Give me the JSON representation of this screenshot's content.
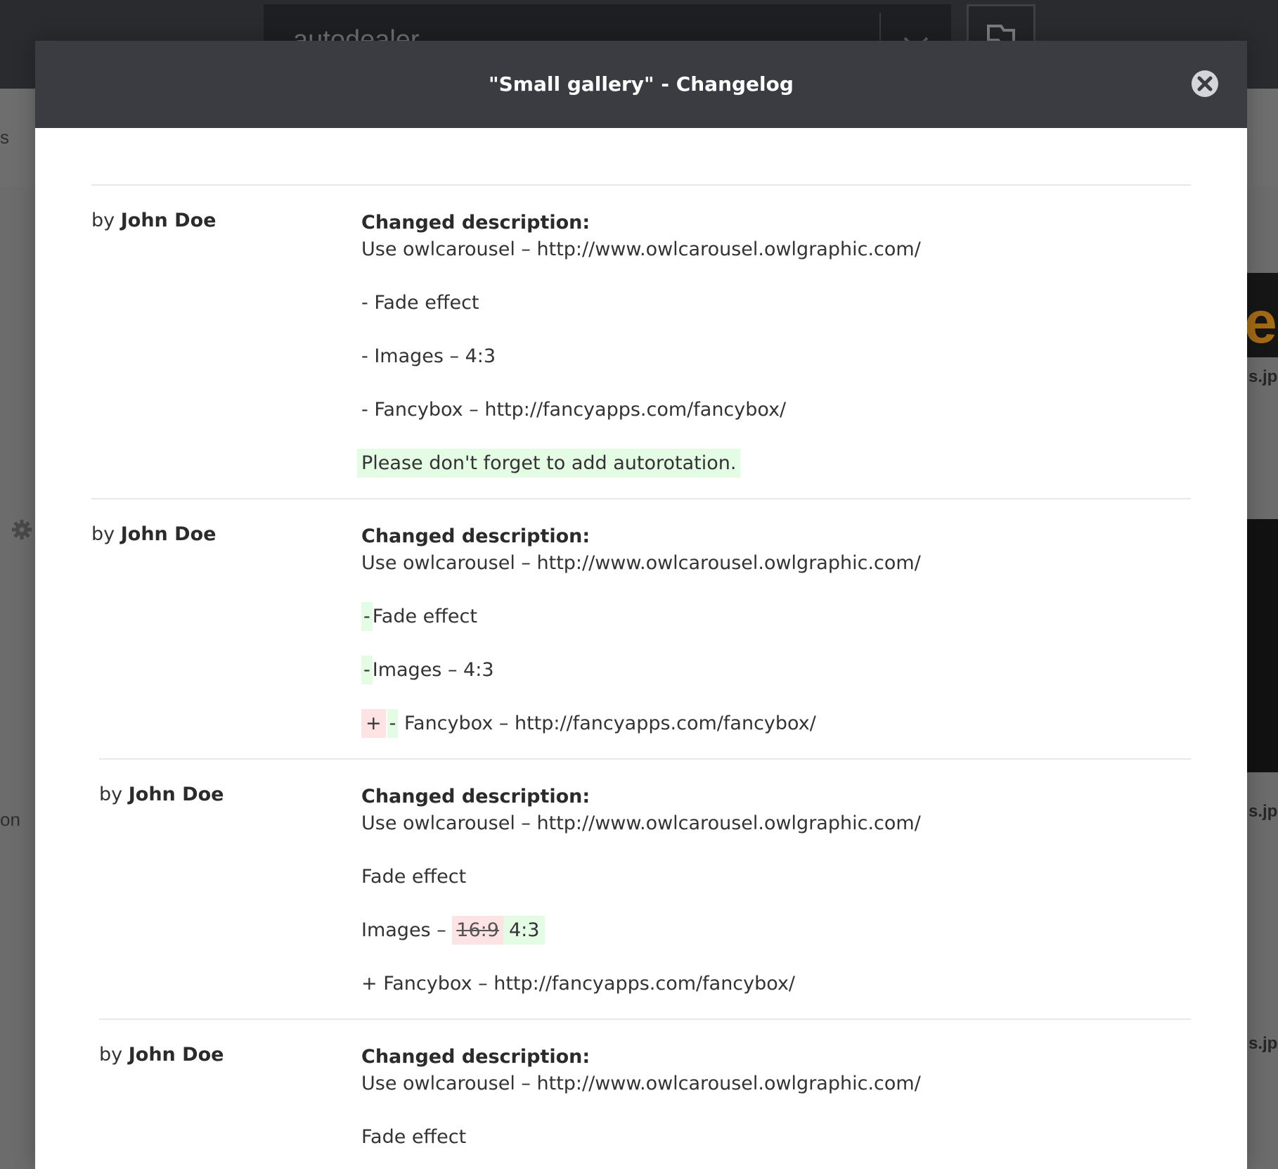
{
  "background": {
    "search_value": "autodealer",
    "left_fragment_1": "s",
    "left_fragment_2": "on",
    "right_file_label": "s.jpg",
    "right_brand_letter": "e"
  },
  "modal": {
    "title": "\"Small gallery\" - Changelog",
    "close_label": "close",
    "entries": [
      {
        "by": "by",
        "author": "John Doe",
        "heading": "Changed description:",
        "line1": "Use owlcarousel – http://www.owlcarousel.owlgraphic.com/",
        "line2": "- Fade effect",
        "line3": "- Images – 4:3",
        "line4": "- Fancybox – http://fancyapps.com/fancybox/",
        "line5_added": "Please don't forget to add autorotation."
      },
      {
        "by": "by",
        "author": "John Doe",
        "heading": "Changed description:",
        "line1": "Use owlcarousel – http://www.owlcarousel.owlgraphic.com/",
        "line2_added": "-",
        "line2_rest": "Fade effect",
        "line3_added": "-",
        "line3_rest": "Images – 4:3",
        "line4_removed": "+",
        "line4_added": "-",
        "line4_rest": "Fancybox – http://fancyapps.com/fancybox/"
      },
      {
        "by": "by",
        "author": "John Doe",
        "heading": "Changed description:",
        "line1": "Use owlcarousel – http://www.owlcarousel.owlgraphic.com/",
        "line2": "Fade effect",
        "line3_prefix": "Images – ",
        "line3_removed": "16:9",
        "line3_added": "4:3",
        "line4": "+ Fancybox – http://fancyapps.com/fancybox/"
      },
      {
        "by": "by",
        "author": "John Doe",
        "heading": "Changed description:",
        "line1": "Use owlcarousel – http://www.owlcarousel.owlgraphic.com/",
        "line2": "Fade effect"
      }
    ]
  },
  "colors": {
    "header_bg": "#3a3c42",
    "added_bg": "#e4fbe4",
    "removed_bg": "#fde3e3"
  }
}
